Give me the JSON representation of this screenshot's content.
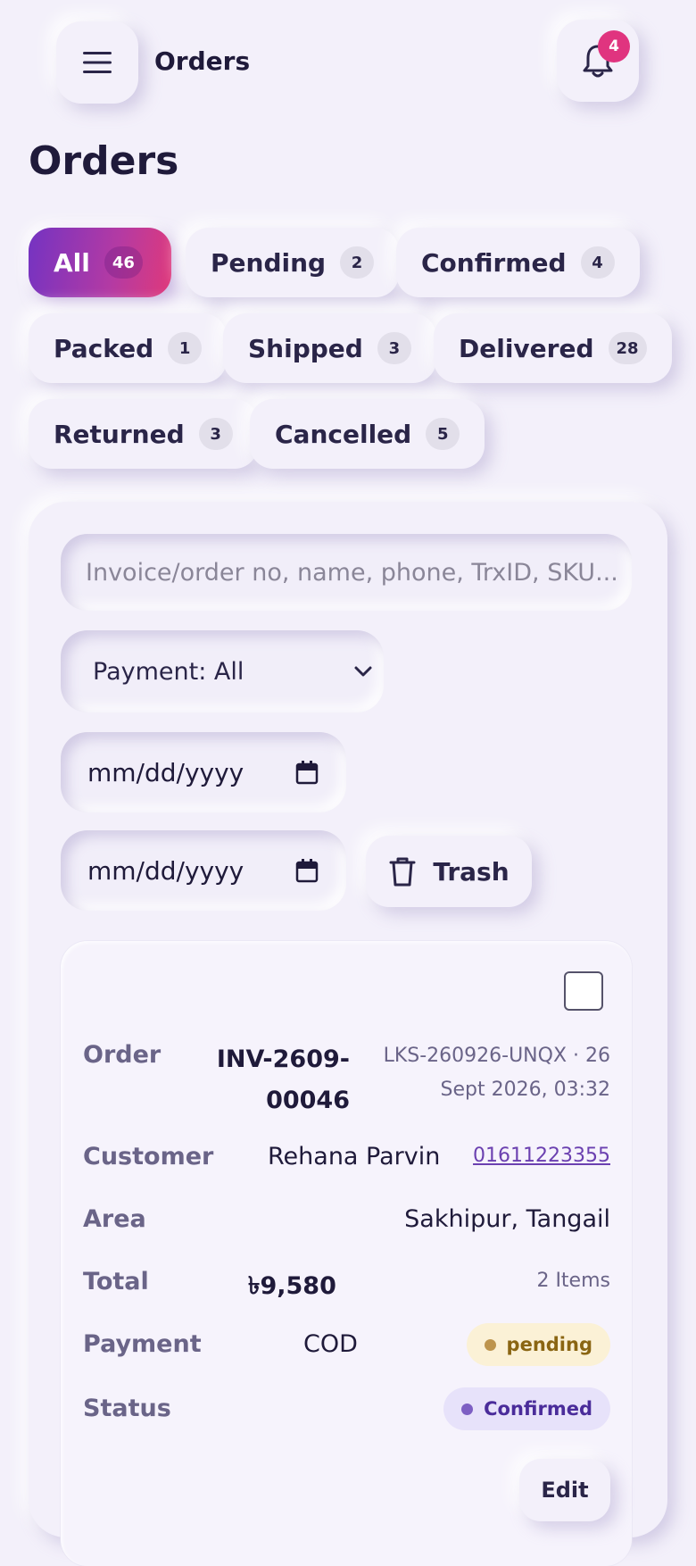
{
  "header": {
    "title": "Orders",
    "notification_count": "4"
  },
  "page_title": "Orders",
  "tabs": [
    {
      "label": "All",
      "count": "46",
      "active": true
    },
    {
      "label": "Pending",
      "count": "2"
    },
    {
      "label": "Confirmed",
      "count": "4"
    },
    {
      "label": "Packed",
      "count": "1"
    },
    {
      "label": "Shipped",
      "count": "3"
    },
    {
      "label": "Delivered",
      "count": "28"
    },
    {
      "label": "Returned",
      "count": "3"
    },
    {
      "label": "Cancelled",
      "count": "5"
    }
  ],
  "filters": {
    "search_placeholder": "Invoice/order no, name, phone, TrxID, SKU...",
    "payment_select": "Payment: All",
    "date_from": "mm/dd/yyyy",
    "date_to": "mm/dd/yyyy",
    "trash_label": "Trash"
  },
  "order": {
    "order_label": "Order",
    "order_no_line1": "INV-2609-",
    "order_no_line2": "00046",
    "meta_line1": "LKS-260926-UNQX · 26",
    "meta_line2": "Sept 2026, 03:32",
    "customer_label": "Customer",
    "customer_name": "Rehana Parvin",
    "phone": "01611223355",
    "area_label": "Area",
    "area": "Sakhipur, Tangail",
    "total_label": "Total",
    "total": "৳9,580",
    "items": "2 Items",
    "payment_label": "Payment",
    "payment_method": "COD",
    "payment_status": "pending",
    "status_label": "Status",
    "status": "Confirmed",
    "edit_label": "Edit"
  }
}
